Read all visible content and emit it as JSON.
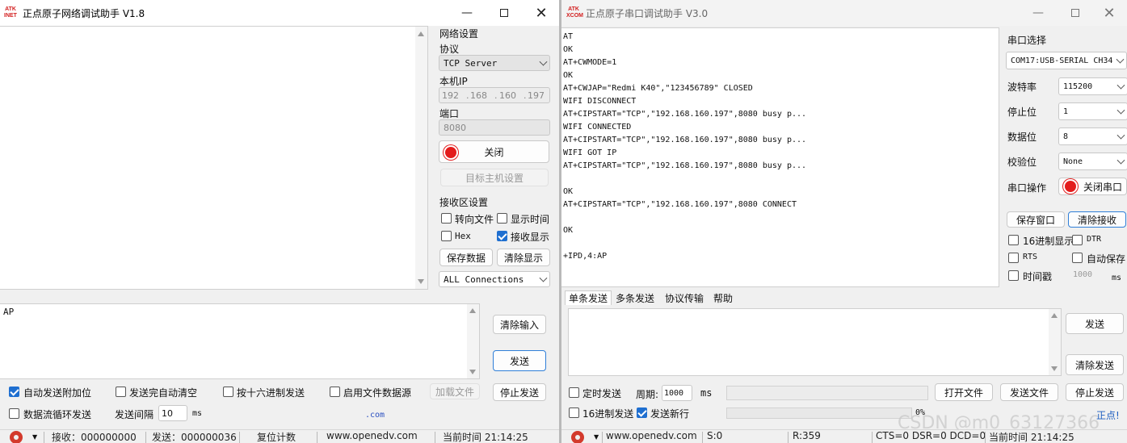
{
  "net": {
    "title": "正点原子网络调试助手 V1.8",
    "logo": "ATK NET",
    "settings": {
      "section": "网络设置",
      "protocol_label": "协议",
      "protocol_value": "TCP Server",
      "ip_label": "本机IP",
      "ip": [
        "192",
        "168",
        "160",
        "197"
      ],
      "port_label": "端口",
      "port_value": "8080",
      "close_label": "关闭",
      "target_label": "目标主机设置"
    },
    "recv": {
      "section": "接收区设置",
      "to_file": "转向文件",
      "show_time": "显示时间",
      "hex": "Hex",
      "recv_show": "接收显示",
      "save_data": "保存数据",
      "clear_show": "清除显示",
      "connections": "ALL Connections"
    },
    "send_text": "AP",
    "clear_input": "清除输入",
    "send": "发送",
    "stop_send": "停止发送",
    "opts": {
      "auto_append": "自动发送附加位",
      "auto_clear": "发送完自动清空",
      "hex_send": "按十六进制发送",
      "file_source": "启用文件数据源",
      "load_file": "加载文件",
      "loop": "数据流循环发送",
      "interval_label": "发送间隔",
      "interval_value": "10",
      "interval_unit": "ms",
      "link": ".com"
    },
    "status": {
      "recv": "接收：000000000",
      "send": "发送：000000036",
      "reset": "复位计数",
      "site": "www.openedv.com",
      "time": "当前时间 21:14:25"
    }
  },
  "serial": {
    "title": "正点原子串口调试助手 V3.0",
    "logo": "ATK XCOM",
    "log": "AT\nOK\nAT+CWMODE=1\nOK\nAT+CWJAP=\"Redmi K40\",\"123456789\" CLOSED\nWIFI DISCONNECT\nAT+CIPSTART=\"TCP\",\"192.168.160.197\",8080 busy p...\nWIFI CONNECTED\nAT+CIPSTART=\"TCP\",\"192.168.160.197\",8080 busy p...\nWIFI GOT IP\nAT+CIPSTART=\"TCP\",\"192.168.160.197\",8080 busy p...\n\nOK\nAT+CIPSTART=\"TCP\",\"192.168.160.197\",8080 CONNECT\n\nOK\n\n+IPD,4:AP",
    "port_label": "串口选择",
    "port_value": "COM17:USB-SERIAL CH34",
    "baud_label": "波特率",
    "baud_value": "115200",
    "stop_label": "停止位",
    "stop_value": "1",
    "data_label": "数据位",
    "data_value": "8",
    "parity_label": "校验位",
    "parity_value": "None",
    "op_label": "串口操作",
    "close_port": "关闭串口",
    "save_window": "保存窗口",
    "clear_recv": "清除接收",
    "hex_show": "16进制显示",
    "dtr": "DTR",
    "rts": "RTS",
    "auto_save": "自动保存",
    "timestamp": "时间戳",
    "ts_value": "1000",
    "ts_unit": "ms",
    "tabs": [
      "单条发送",
      "多条发送",
      "协议传输",
      "帮助"
    ],
    "send": "发送",
    "clear_send": "清除发送",
    "timed_send": "定时发送",
    "period_label": "周期:",
    "period_value": "1000",
    "period_unit": "ms",
    "open_file": "打开文件",
    "send_file": "发送文件",
    "stop_send": "停止发送",
    "hex_send": "16进制发送",
    "newline": "发送新行",
    "progress": "0%",
    "brand": "正点!",
    "status": {
      "site": "www.openedv.com",
      "s": "S:0",
      "r": "R:359",
      "lines": "CTS=0 DSR=0 DCD=0",
      "time": "当前时间 21:14:25"
    },
    "watermark": "CSDN @m0_63127366"
  }
}
